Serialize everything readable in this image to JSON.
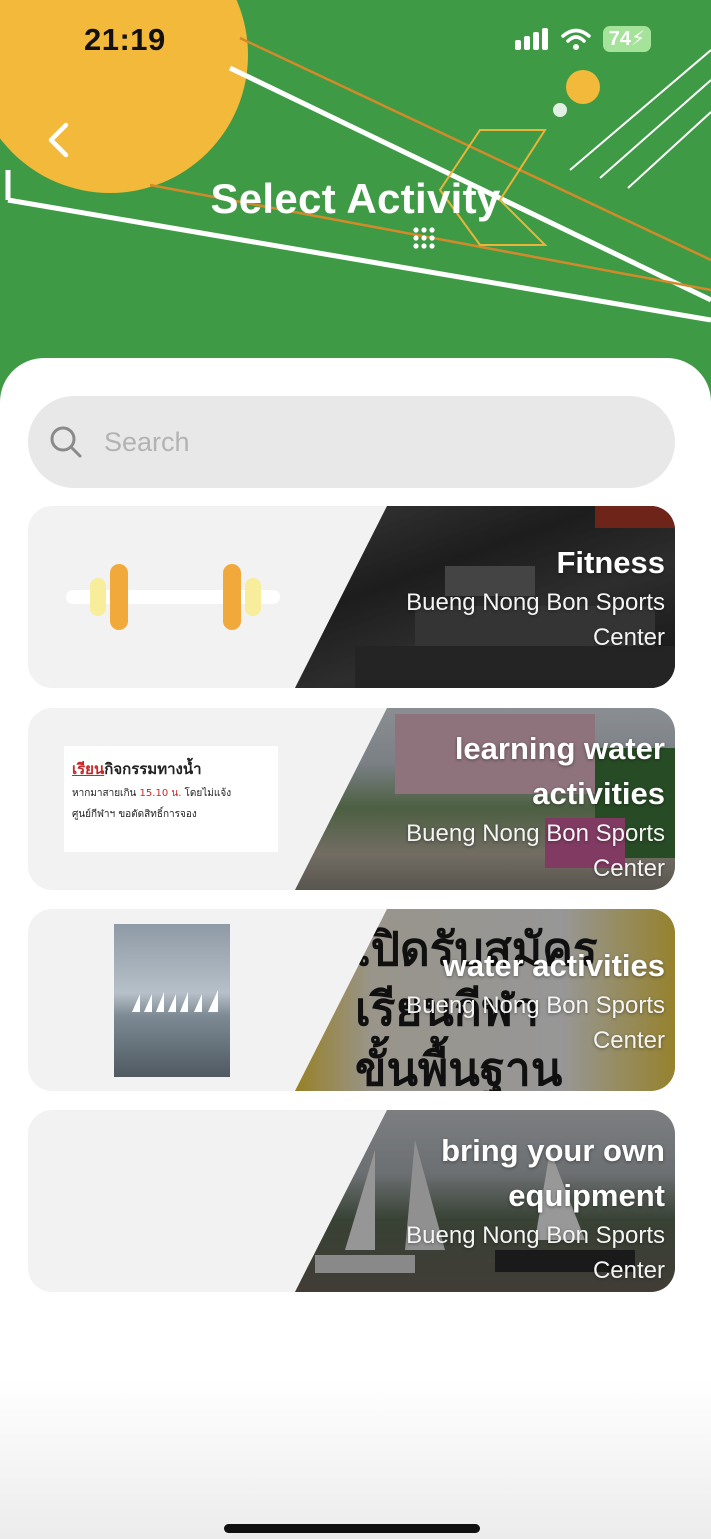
{
  "status_bar": {
    "time": "21:19",
    "battery": "74"
  },
  "header": {
    "title": "Select Activity"
  },
  "search": {
    "placeholder": "Search"
  },
  "activities": [
    {
      "name": "Fitness",
      "venue": "Bueng Nong Bon Sports Center",
      "thumb_icon": "dumbbell-icon"
    },
    {
      "name": "learning water activities",
      "venue": "Bueng Nong Bon Sports Center",
      "thumb_line1_red": "เรียน",
      "thumb_line1": "กิจกรรมทางน้ำ",
      "thumb_line2_a": "หากมาสายเกิน ",
      "thumb_line2_red": "15.10 น.",
      "thumb_line2_b": " โดยไม่แจ้ง",
      "thumb_line3": "ศูนย์กีฬาฯ ขอตัดสิทธิ์การจอง"
    },
    {
      "name": "water activities",
      "venue": "Bueng Nong Bon Sports Center",
      "photo_text_1": "เปิดรับสมัคร",
      "photo_text_2": "เรียนกีฬา",
      "photo_text_3": "ขั้นพื้นฐาน"
    },
    {
      "name": "bring your own equipment",
      "venue": "Bueng Nong Bon Sports Center"
    }
  ],
  "colors": {
    "header_green": "#3f9a46",
    "accent_yellow": "#f2b93b",
    "card_bg": "#f2f2f2"
  }
}
